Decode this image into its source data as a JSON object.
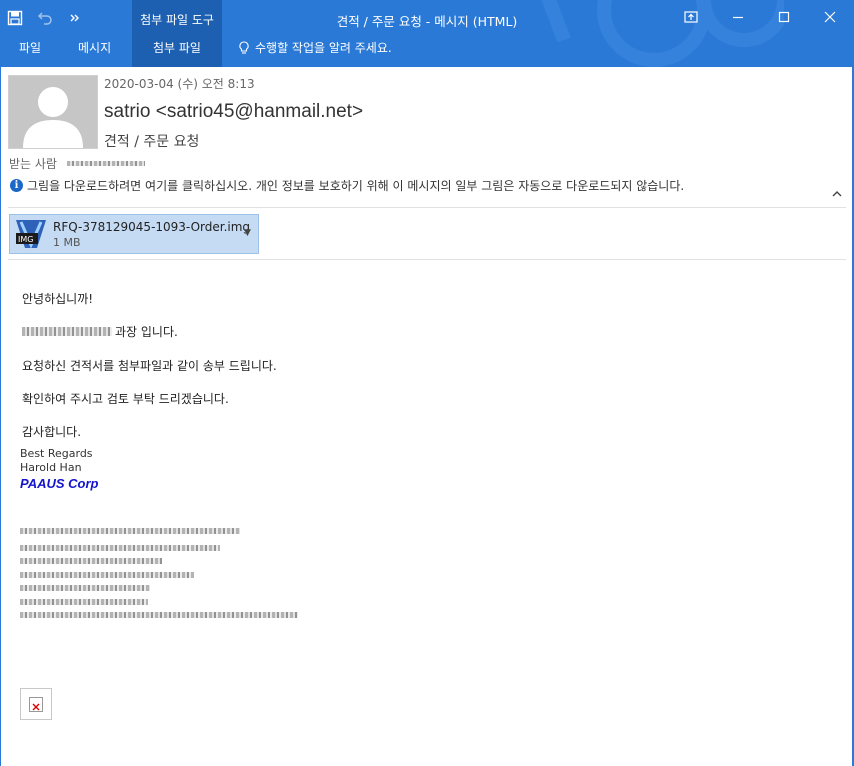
{
  "window": {
    "title": "견적 / 주문 요청 - 메시지 (HTML)",
    "context_group": "첨부 파일 도구",
    "accent": "#2b79d6",
    "controls": [
      "restore-ribbon-icon",
      "minimize-icon",
      "maximize-icon",
      "close-icon"
    ]
  },
  "qat": [
    "save-icon",
    "undo-icon",
    "more-icon"
  ],
  "ribbon": {
    "tabs": [
      "파일",
      "메시지",
      "첨부 파일"
    ],
    "tell_me": "수행할 작업을 알려 주세요."
  },
  "header": {
    "date": "2020-03-04 (수) 오전 8:13",
    "sender": "satrio <satrio45@hanmail.net>",
    "subject": "견적 / 주문 요청",
    "to_label": "받는 사람",
    "info_bar": "그림을 다운로드하려면 여기를 클릭하십시오. 개인 정보를 보호하기 위해 이 메시지의 일부 그림은 자동으로 다운로드되지 않습니다."
  },
  "attachment": {
    "name": "RFQ-378129045-1093-Order.img",
    "size": "1 MB",
    "icon_label": "IMG"
  },
  "body": {
    "greeting": "안녕하십니까!",
    "line2": "과장 입니다.",
    "line3": "요청하신 견적서를 첨부파일과 같이 송부 드립니다.",
    "line4": "확인하여 주시고 검토 부탁 드리겠습니다.",
    "line5": "감사합니다."
  },
  "signature": {
    "regards": "Best Regards",
    "name": "Harold Han",
    "company": "PAAUS Corp"
  }
}
